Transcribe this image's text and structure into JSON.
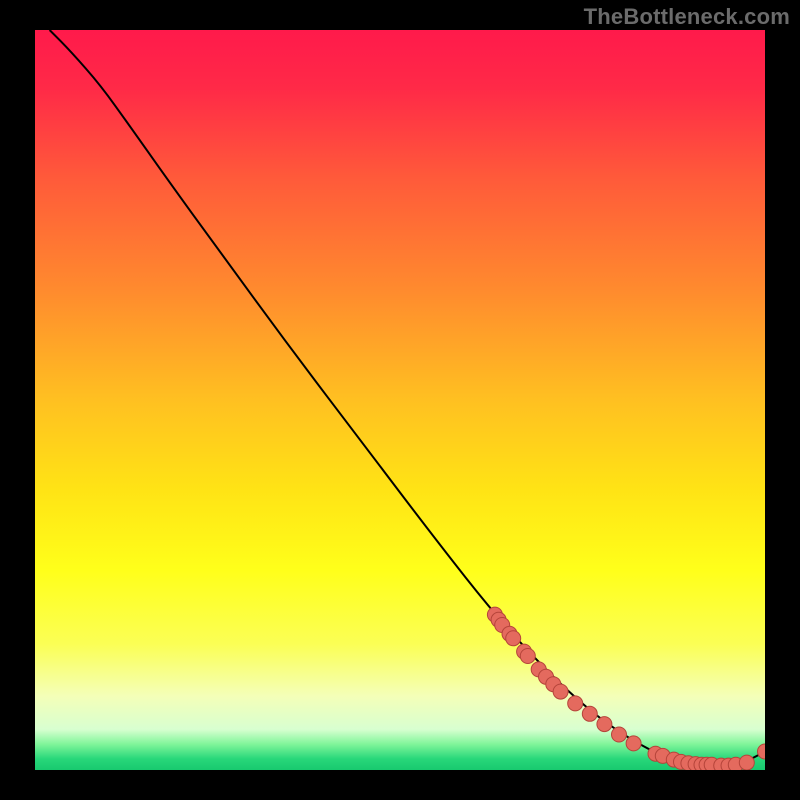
{
  "watermark": "TheBottleneck.com",
  "colors": {
    "background": "#000000",
    "watermark": "#6b6b6b",
    "curve": "#000000",
    "marker_fill": "#e46a5e",
    "marker_stroke": "#b5443a",
    "gradient_stops": [
      {
        "offset": 0.0,
        "color": "#ff1a4b"
      },
      {
        "offset": 0.08,
        "color": "#ff2a47"
      },
      {
        "offset": 0.2,
        "color": "#ff5a3a"
      },
      {
        "offset": 0.35,
        "color": "#ff8a2e"
      },
      {
        "offset": 0.5,
        "color": "#ffc021"
      },
      {
        "offset": 0.62,
        "color": "#ffe315"
      },
      {
        "offset": 0.73,
        "color": "#ffff1a"
      },
      {
        "offset": 0.83,
        "color": "#fbff55"
      },
      {
        "offset": 0.9,
        "color": "#f4ffb8"
      },
      {
        "offset": 0.945,
        "color": "#d8ffd0"
      },
      {
        "offset": 0.965,
        "color": "#80f59a"
      },
      {
        "offset": 0.985,
        "color": "#28d77a"
      },
      {
        "offset": 1.0,
        "color": "#18c96f"
      }
    ]
  },
  "chart_data": {
    "type": "line",
    "title": "",
    "xlabel": "",
    "ylabel": "",
    "xlim": [
      0,
      100
    ],
    "ylim": [
      0,
      100
    ],
    "grid": false,
    "legend": false,
    "annotations": [],
    "series": [
      {
        "name": "curve",
        "style": "line",
        "x": [
          2,
          5,
          9,
          13,
          18,
          25,
          35,
          45,
          55,
          63,
          70,
          76,
          81,
          85,
          88,
          91,
          94,
          97,
          100
        ],
        "y": [
          100,
          97,
          92.5,
          87,
          80,
          70.5,
          57,
          44,
          31,
          21,
          13.5,
          8,
          4.5,
          2.3,
          1.2,
          0.7,
          0.5,
          0.9,
          2.5
        ]
      },
      {
        "name": "markers",
        "style": "scatter",
        "x": [
          63,
          63.5,
          64,
          65,
          65.5,
          67,
          67.5,
          69,
          70,
          71,
          72,
          74,
          76,
          78,
          80,
          82,
          85,
          86,
          87.5,
          88.5,
          89.5,
          90.5,
          91.3,
          92,
          92.7,
          94,
          95,
          96,
          97.5,
          100
        ],
        "y": [
          21,
          20.3,
          19.6,
          18.4,
          17.8,
          16,
          15.4,
          13.6,
          12.6,
          11.6,
          10.6,
          9,
          7.6,
          6.2,
          4.8,
          3.6,
          2.2,
          1.9,
          1.4,
          1.1,
          0.9,
          0.8,
          0.7,
          0.7,
          0.7,
          0.6,
          0.6,
          0.7,
          1,
          2.5
        ]
      }
    ]
  }
}
